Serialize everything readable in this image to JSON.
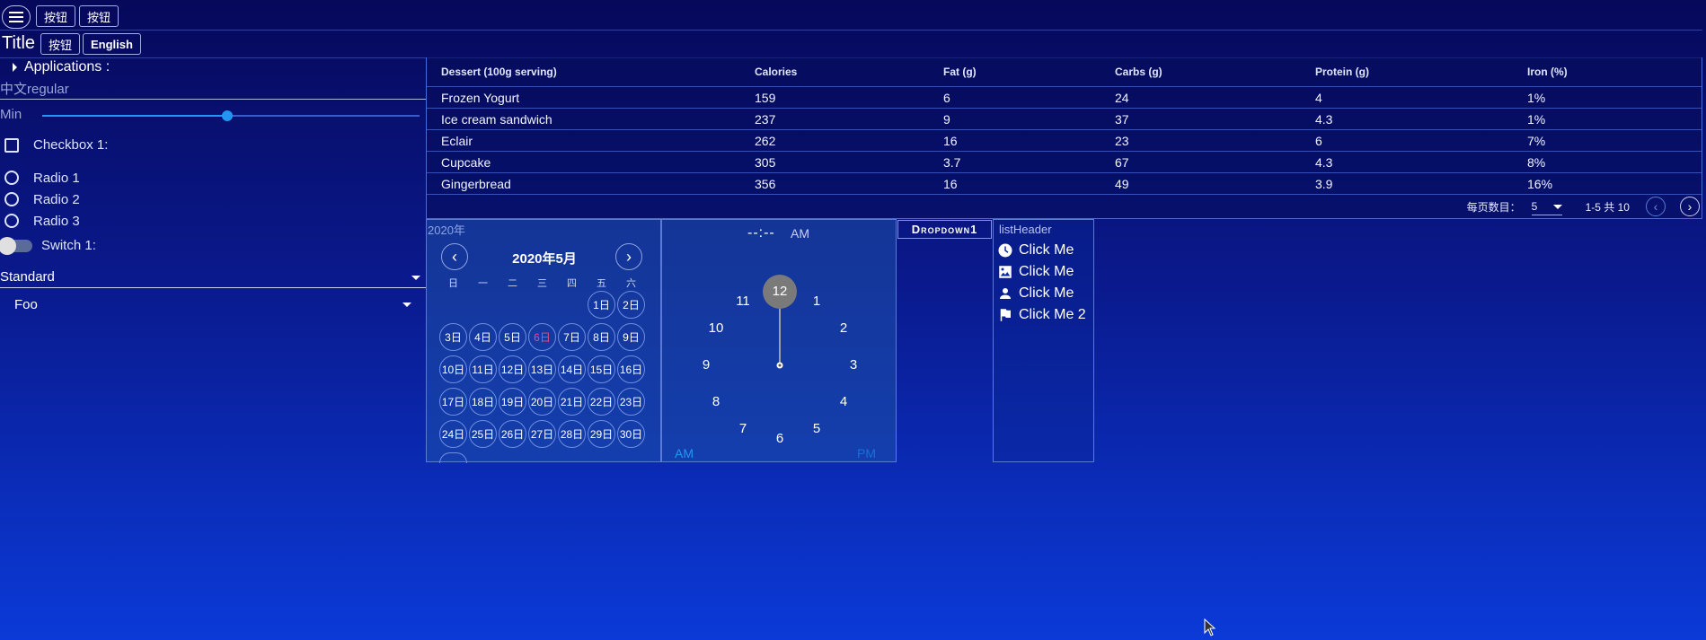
{
  "topbar": {
    "btn1": "按钮",
    "btn2": "按钮"
  },
  "titlebar": {
    "title": "Title",
    "btn": "按钮",
    "lang": "English"
  },
  "left": {
    "applications": "Applications :",
    "text_field_value": "中文regular",
    "slider_label": "Min",
    "slider_value": 0.5,
    "checkbox_label": "Checkbox 1:",
    "radios": [
      "Radio 1",
      "Radio 2",
      "Radio 3"
    ],
    "switch_label": "Switch 1:",
    "select1": "Standard",
    "select2": "Foo"
  },
  "table": {
    "headers": [
      "Dessert (100g serving)",
      "Calories",
      "Fat (g)",
      "Carbs (g)",
      "Protein (g)",
      "Iron (%)"
    ],
    "rows": [
      [
        "Frozen Yogurt",
        "159",
        "6",
        "24",
        "4",
        "1%"
      ],
      [
        "Ice cream sandwich",
        "237",
        "9",
        "37",
        "4.3",
        "1%"
      ],
      [
        "Eclair",
        "262",
        "16",
        "23",
        "6",
        "7%"
      ],
      [
        "Cupcake",
        "305",
        "3.7",
        "67",
        "4.3",
        "8%"
      ],
      [
        "Gingerbread",
        "356",
        "16",
        "49",
        "3.9",
        "16%"
      ]
    ],
    "rows_per_page_label": "每页数目：",
    "rows_per_page": "5",
    "range": "1-5 共 10"
  },
  "calendar": {
    "year": "2020年",
    "month": "2020年5月",
    "weekdays": [
      "日",
      "一",
      "二",
      "三",
      "四",
      "五",
      "六"
    ],
    "days": [
      "1日",
      "2日",
      "3日",
      "4日",
      "5日",
      "6日",
      "7日",
      "8日",
      "9日",
      "10日",
      "11日",
      "12日",
      "13日",
      "14日",
      "15日",
      "16日",
      "17日",
      "18日",
      "19日",
      "20日",
      "21日",
      "22日",
      "23日",
      "24日",
      "25日",
      "26日",
      "27日",
      "28日",
      "29日",
      "30日"
    ],
    "today": "6日"
  },
  "clock": {
    "time": "--:--",
    "ampm": "AM",
    "numbers": [
      "12",
      "1",
      "2",
      "3",
      "4",
      "5",
      "6",
      "7",
      "8",
      "9",
      "10",
      "11"
    ],
    "am": "AM",
    "pm": "PM"
  },
  "dropdown": {
    "label": "Dropdown1"
  },
  "list": {
    "header": "listHeader",
    "items": [
      {
        "icon": "clock-icon",
        "label": "Click Me"
      },
      {
        "icon": "photo-icon",
        "label": "Click Me"
      },
      {
        "icon": "person-icon",
        "label": "Click Me"
      },
      {
        "icon": "flag-icon",
        "label": "Click Me 2"
      }
    ]
  },
  "colors": {
    "accent": "#2196f3",
    "today": "#ff4081",
    "selected_hour": "#7a7a7a"
  }
}
